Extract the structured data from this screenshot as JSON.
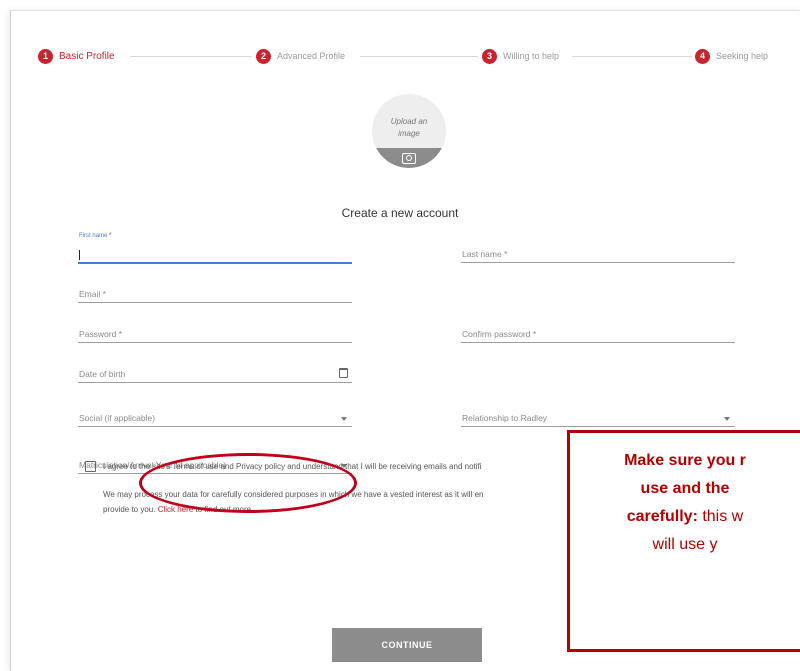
{
  "stepper": {
    "steps": [
      {
        "num": "1",
        "label": "Basic Profile"
      },
      {
        "num": "2",
        "label": "Advanced Profile"
      },
      {
        "num": "3",
        "label": "Willing to help"
      },
      {
        "num": "4",
        "label": "Seeking help"
      }
    ]
  },
  "upload": {
    "line1": "Upload an",
    "line2": "image"
  },
  "form": {
    "title": "Create a new account",
    "first_name_float": "First name",
    "last_name": "Last name",
    "email": "Email",
    "password": "Password",
    "confirm_password": "Confirm password",
    "dob": "Date of birth",
    "social": "Social (if applicable)",
    "relationship": "Relationship to Radley",
    "matriculation": "Matriculation/Arrival Year (if applicable)",
    "required_mark": "*"
  },
  "agree": {
    "prefix": "I agree to the site's",
    "terms": "Terms of use",
    "and": "and",
    "privacy": "Privacy policy",
    "suffix": "and understand that I will be receiving emails and notifi"
  },
  "note": {
    "text": "We may process your data for carefully considered purposes in which we have a vested interest as it will en",
    "line2_prefix": "provide to you.",
    "link": "Click here",
    "line2_suffix": "to find out more."
  },
  "callout": {
    "line1": "Make sure you r",
    "line2": "use and the",
    "line3_bold": "carefully:",
    "line3_rest": " this w",
    "line4": "will use y"
  },
  "continue_label": "CONTINUE",
  "colors": {
    "accent": "#c9232d",
    "focus": "#3f7fd8",
    "annotation": "#b30000"
  }
}
